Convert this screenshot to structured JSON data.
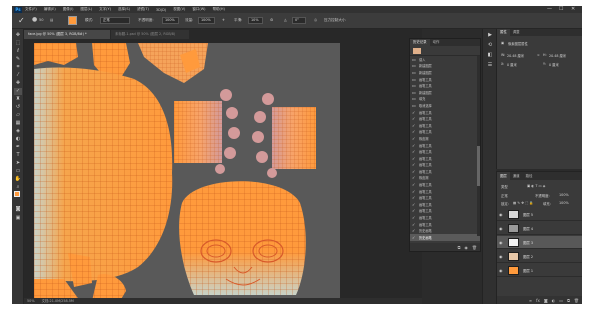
{
  "app": {
    "logo": "Ps",
    "menu": [
      "文件(F)",
      "编辑(E)",
      "图像(I)",
      "图层(L)",
      "文字(Y)",
      "选择(S)",
      "滤镜(T)",
      "3D(D)",
      "视图(V)",
      "窗口(W)",
      "帮助(H)"
    ],
    "window_controls": [
      "—",
      "☐",
      "✕"
    ]
  },
  "options_bar": {
    "brush_size": "50",
    "mode_label": "模式:",
    "mode_value": "正常",
    "opacity_label": "不透明度:",
    "opacity_value": "100%",
    "flow_label": "流量:",
    "flow_value": "100%",
    "smoothing_label": "平滑:",
    "smoothing_value": "10%",
    "angle_value": "0°",
    "pressure_label": "压力控制大小",
    "color_accent": "#ff9a3c"
  },
  "tabs": [
    {
      "label": "face.jpg @ 50% (图层 3, RGB/8#) *",
      "active": true
    },
    {
      "label": "未标题-1.psd @ 50% (图层 2, RGB/8)",
      "active": false
    }
  ],
  "tools": [
    "move-icon",
    "marquee-icon",
    "lasso-icon",
    "quick-select-icon",
    "crop-icon",
    "eyedropper-icon",
    "healing-icon",
    "brush-icon",
    "stamp-icon",
    "history-brush-icon",
    "eraser-icon",
    "gradient-icon",
    "blur-icon",
    "dodge-icon",
    "pen-icon",
    "type-icon",
    "path-select-icon",
    "shape-icon",
    "hand-icon",
    "zoom-icon"
  ],
  "status_bar": {
    "zoom": "50%",
    "doc_info": "文档:21.0M/258.5M"
  },
  "history": {
    "tabs": [
      "历史记录",
      "动作"
    ],
    "items": [
      {
        "icon": "layer-icon",
        "label": "载入"
      },
      {
        "icon": "layer-icon",
        "label": "新建图层"
      },
      {
        "icon": "layer-icon",
        "label": "新建图层"
      },
      {
        "icon": "layer-icon",
        "label": "画笔工具"
      },
      {
        "icon": "layer-icon",
        "label": "画笔工具"
      },
      {
        "icon": "layer-icon",
        "label": "新建图层"
      },
      {
        "icon": "layer-icon",
        "label": "填充"
      },
      {
        "icon": "layer-icon",
        "label": "取消选择"
      },
      {
        "icon": "brush-icon",
        "label": "画笔工具"
      },
      {
        "icon": "brush-icon",
        "label": "画笔工具"
      },
      {
        "icon": "brush-icon",
        "label": "画笔工具"
      },
      {
        "icon": "brush-icon",
        "label": "画笔工具"
      },
      {
        "icon": "brush-icon",
        "label": "橡皮擦"
      },
      {
        "icon": "brush-icon",
        "label": "画笔工具"
      },
      {
        "icon": "brush-icon",
        "label": "画笔工具"
      },
      {
        "icon": "brush-icon",
        "label": "画笔工具"
      },
      {
        "icon": "brush-icon",
        "label": "画笔工具"
      },
      {
        "icon": "brush-icon",
        "label": "画笔工具"
      },
      {
        "icon": "brush-icon",
        "label": "橡皮擦"
      },
      {
        "icon": "brush-icon",
        "label": "画笔工具"
      },
      {
        "icon": "brush-icon",
        "label": "画笔工具"
      },
      {
        "icon": "brush-icon",
        "label": "画笔工具"
      },
      {
        "icon": "brush-icon",
        "label": "画笔工具"
      },
      {
        "icon": "brush-icon",
        "label": "画笔工具"
      },
      {
        "icon": "brush-icon",
        "label": "画笔工具"
      },
      {
        "icon": "brush-icon",
        "label": "画笔工具"
      },
      {
        "icon": "brush-icon",
        "label": "历史画笔"
      },
      {
        "icon": "brush-icon",
        "label": "历史画笔"
      }
    ]
  },
  "properties": {
    "tabs": [
      "属性",
      "调整"
    ],
    "title": "像素图层属性",
    "w_label": "W:",
    "w_value": "20.48 厘米",
    "h_label": "H:",
    "h_value": "20.48 厘米",
    "x_label": "X:",
    "x_value": "0 厘米",
    "y_label": "Y:",
    "y_value": "0 厘米"
  },
  "layers": {
    "tabs": [
      "图层",
      "通道",
      "路径"
    ],
    "filter": "类型",
    "blend_mode": "正常",
    "opacity_label": "不透明度:",
    "opacity_value": "100%",
    "lock_label": "锁定:",
    "fill_label": "填充:",
    "fill_value": "100%",
    "items": [
      {
        "name": "图层 5",
        "selected": false
      },
      {
        "name": "图层 4",
        "selected": false
      },
      {
        "name": "图层 3",
        "selected": true
      },
      {
        "name": "图层 2",
        "selected": false
      },
      {
        "name": "图层 1",
        "selected": false
      }
    ]
  }
}
